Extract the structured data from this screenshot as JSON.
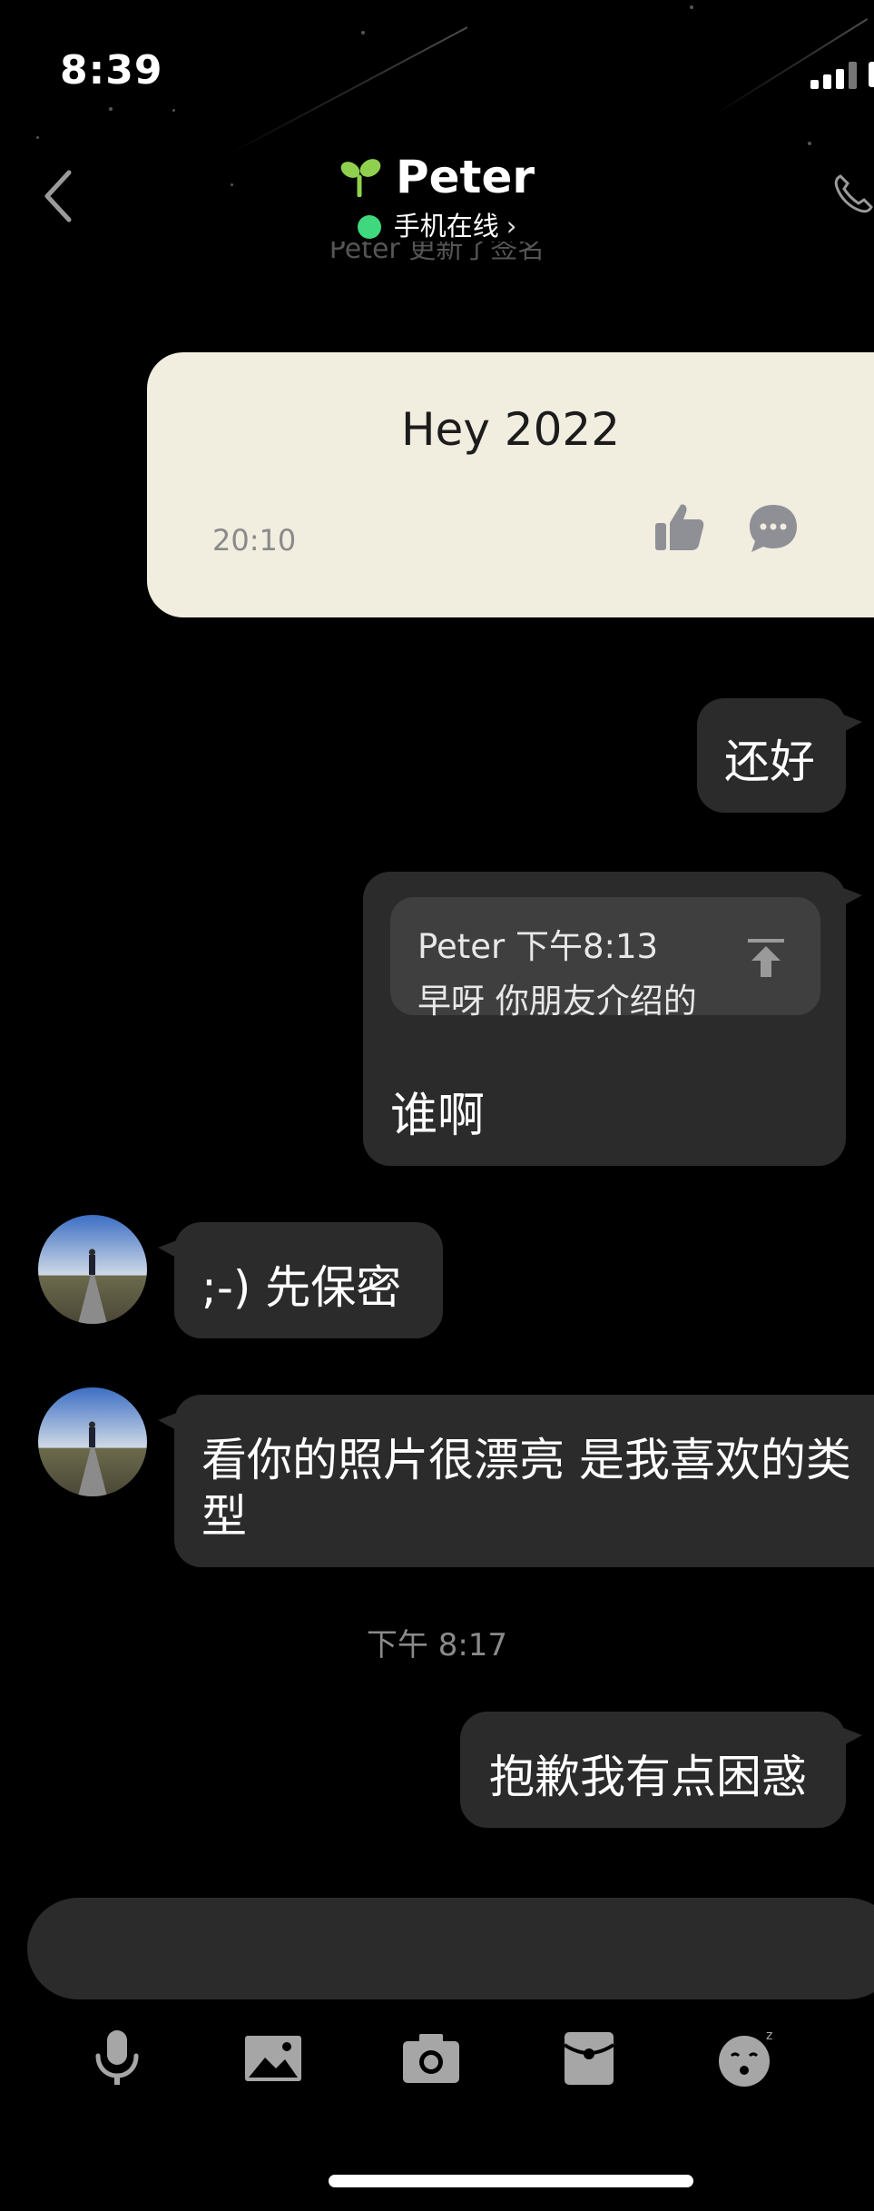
{
  "status_bar": {
    "time": "8:39"
  },
  "header": {
    "contact_name": "Peter",
    "online_status": "手机在线",
    "online_chevron": "›",
    "signature_notice": "Peter 更新了签名"
  },
  "signature_card": {
    "text": "Hey 2022",
    "time": "20:10"
  },
  "messages": {
    "m1": "还好",
    "m2_quote_header": "Peter 下午8:13",
    "m2_quote_body": "早呀 你朋友介绍的",
    "m2_text": "谁啊",
    "m3": ";-) 先保密",
    "m4_line1": "看你的照片很漂亮 是我喜欢的类",
    "m4_line2": "型",
    "timestamp": "下午 8:17",
    "m5": "抱歉我有点困惑"
  },
  "input": {
    "placeholder": ""
  },
  "toolbar": {
    "icons": [
      "microphone-icon",
      "image-icon",
      "camera-icon",
      "red-packet-icon",
      "emoji-icon"
    ]
  },
  "colors": {
    "background": "#000000",
    "bubble": "#2b2b2b",
    "signature_card": "#f1eddf",
    "online": "#3fd87e",
    "sprout": "#8fd14f"
  }
}
